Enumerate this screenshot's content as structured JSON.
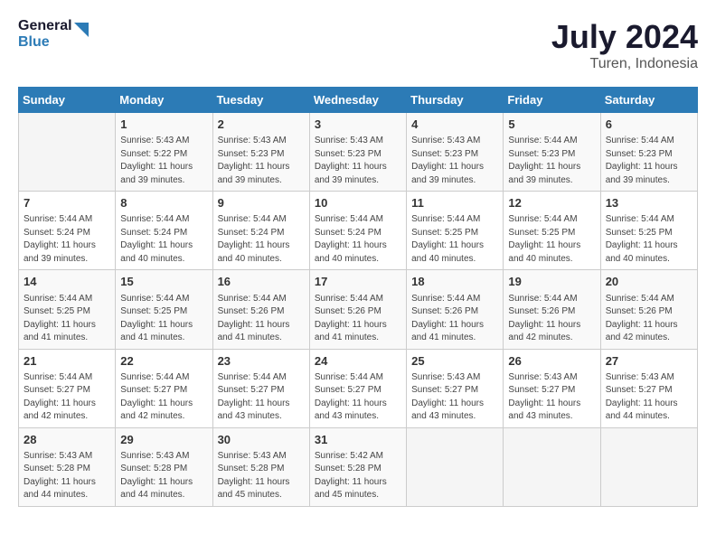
{
  "header": {
    "logo_line1": "General",
    "logo_line2": "Blue",
    "month": "July 2024",
    "location": "Turen, Indonesia"
  },
  "weekdays": [
    "Sunday",
    "Monday",
    "Tuesday",
    "Wednesday",
    "Thursday",
    "Friday",
    "Saturday"
  ],
  "weeks": [
    [
      {
        "day": "",
        "empty": true
      },
      {
        "day": "1",
        "sunrise": "5:43 AM",
        "sunset": "5:22 PM",
        "daylight": "11 hours and 39 minutes."
      },
      {
        "day": "2",
        "sunrise": "5:43 AM",
        "sunset": "5:23 PM",
        "daylight": "11 hours and 39 minutes."
      },
      {
        "day": "3",
        "sunrise": "5:43 AM",
        "sunset": "5:23 PM",
        "daylight": "11 hours and 39 minutes."
      },
      {
        "day": "4",
        "sunrise": "5:43 AM",
        "sunset": "5:23 PM",
        "daylight": "11 hours and 39 minutes."
      },
      {
        "day": "5",
        "sunrise": "5:44 AM",
        "sunset": "5:23 PM",
        "daylight": "11 hours and 39 minutes."
      },
      {
        "day": "6",
        "sunrise": "5:44 AM",
        "sunset": "5:23 PM",
        "daylight": "11 hours and 39 minutes."
      }
    ],
    [
      {
        "day": "7",
        "sunrise": "5:44 AM",
        "sunset": "5:24 PM",
        "daylight": "11 hours and 39 minutes."
      },
      {
        "day": "8",
        "sunrise": "5:44 AM",
        "sunset": "5:24 PM",
        "daylight": "11 hours and 40 minutes."
      },
      {
        "day": "9",
        "sunrise": "5:44 AM",
        "sunset": "5:24 PM",
        "daylight": "11 hours and 40 minutes."
      },
      {
        "day": "10",
        "sunrise": "5:44 AM",
        "sunset": "5:24 PM",
        "daylight": "11 hours and 40 minutes."
      },
      {
        "day": "11",
        "sunrise": "5:44 AM",
        "sunset": "5:25 PM",
        "daylight": "11 hours and 40 minutes."
      },
      {
        "day": "12",
        "sunrise": "5:44 AM",
        "sunset": "5:25 PM",
        "daylight": "11 hours and 40 minutes."
      },
      {
        "day": "13",
        "sunrise": "5:44 AM",
        "sunset": "5:25 PM",
        "daylight": "11 hours and 40 minutes."
      }
    ],
    [
      {
        "day": "14",
        "sunrise": "5:44 AM",
        "sunset": "5:25 PM",
        "daylight": "11 hours and 41 minutes."
      },
      {
        "day": "15",
        "sunrise": "5:44 AM",
        "sunset": "5:25 PM",
        "daylight": "11 hours and 41 minutes."
      },
      {
        "day": "16",
        "sunrise": "5:44 AM",
        "sunset": "5:26 PM",
        "daylight": "11 hours and 41 minutes."
      },
      {
        "day": "17",
        "sunrise": "5:44 AM",
        "sunset": "5:26 PM",
        "daylight": "11 hours and 41 minutes."
      },
      {
        "day": "18",
        "sunrise": "5:44 AM",
        "sunset": "5:26 PM",
        "daylight": "11 hours and 41 minutes."
      },
      {
        "day": "19",
        "sunrise": "5:44 AM",
        "sunset": "5:26 PM",
        "daylight": "11 hours and 42 minutes."
      },
      {
        "day": "20",
        "sunrise": "5:44 AM",
        "sunset": "5:26 PM",
        "daylight": "11 hours and 42 minutes."
      }
    ],
    [
      {
        "day": "21",
        "sunrise": "5:44 AM",
        "sunset": "5:27 PM",
        "daylight": "11 hours and 42 minutes."
      },
      {
        "day": "22",
        "sunrise": "5:44 AM",
        "sunset": "5:27 PM",
        "daylight": "11 hours and 42 minutes."
      },
      {
        "day": "23",
        "sunrise": "5:44 AM",
        "sunset": "5:27 PM",
        "daylight": "11 hours and 43 minutes."
      },
      {
        "day": "24",
        "sunrise": "5:44 AM",
        "sunset": "5:27 PM",
        "daylight": "11 hours and 43 minutes."
      },
      {
        "day": "25",
        "sunrise": "5:43 AM",
        "sunset": "5:27 PM",
        "daylight": "11 hours and 43 minutes."
      },
      {
        "day": "26",
        "sunrise": "5:43 AM",
        "sunset": "5:27 PM",
        "daylight": "11 hours and 43 minutes."
      },
      {
        "day": "27",
        "sunrise": "5:43 AM",
        "sunset": "5:27 PM",
        "daylight": "11 hours and 44 minutes."
      }
    ],
    [
      {
        "day": "28",
        "sunrise": "5:43 AM",
        "sunset": "5:28 PM",
        "daylight": "11 hours and 44 minutes."
      },
      {
        "day": "29",
        "sunrise": "5:43 AM",
        "sunset": "5:28 PM",
        "daylight": "11 hours and 44 minutes."
      },
      {
        "day": "30",
        "sunrise": "5:43 AM",
        "sunset": "5:28 PM",
        "daylight": "11 hours and 45 minutes."
      },
      {
        "day": "31",
        "sunrise": "5:42 AM",
        "sunset": "5:28 PM",
        "daylight": "11 hours and 45 minutes."
      },
      {
        "day": "",
        "empty": true
      },
      {
        "day": "",
        "empty": true
      },
      {
        "day": "",
        "empty": true
      }
    ]
  ],
  "labels": {
    "sunrise": "Sunrise:",
    "sunset": "Sunset:",
    "daylight": "Daylight:"
  }
}
